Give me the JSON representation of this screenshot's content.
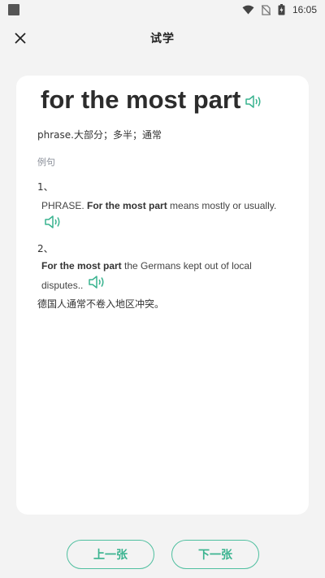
{
  "status_bar": {
    "time": "16:05"
  },
  "header": {
    "title": "试学"
  },
  "card": {
    "headword": "for the most part",
    "definition": "phrase.大部分；多半；通常",
    "examples_label": "例句",
    "examples": [
      {
        "index": "1、",
        "pre": "PHRASE. ",
        "bold": "For the most part",
        "post": " means mostly or usually."
      },
      {
        "index": "2、",
        "bold": "For the most part",
        "post_line1": " the Germans kept out of local",
        "line2": "disputes..",
        "translation": "德国人通常不卷入地区冲突。"
      }
    ]
  },
  "nav": {
    "prev_label": "上一张",
    "next_label": "下一张"
  },
  "colors": {
    "accent": "#39b38f",
    "background": "#f3f3f3",
    "card": "#ffffff"
  }
}
